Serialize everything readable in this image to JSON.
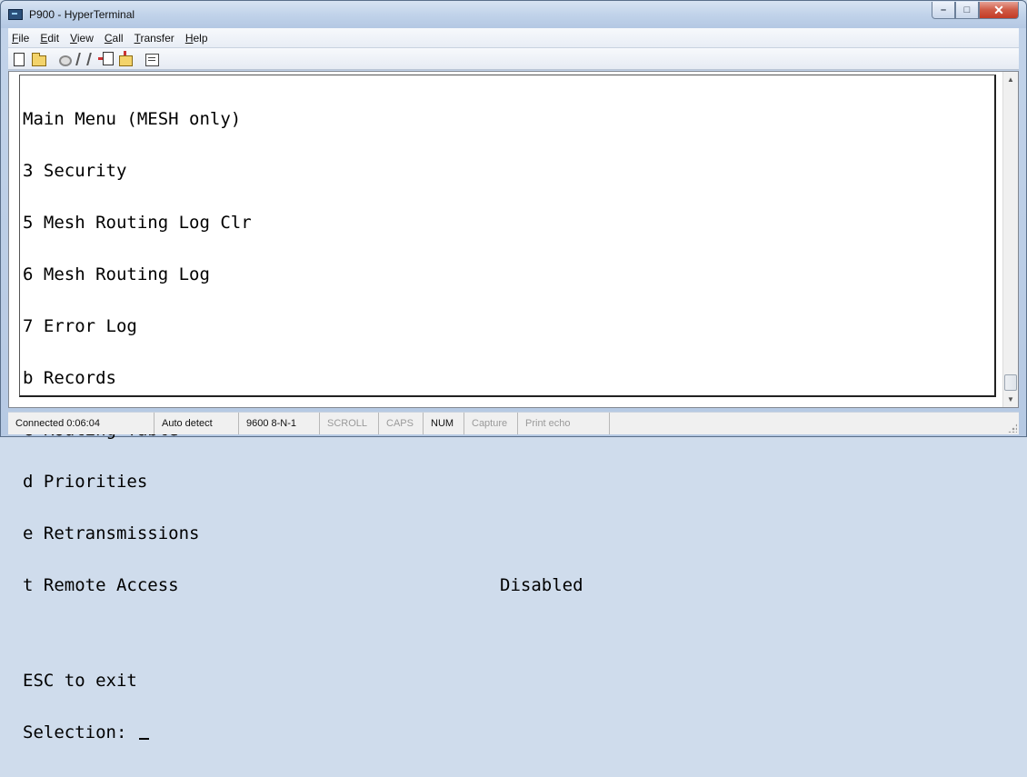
{
  "window": {
    "title": "P900 - HyperTerminal",
    "controls": {
      "minimize": "–",
      "maximize": "□",
      "close": "✕"
    }
  },
  "menubar": [
    {
      "key": "F",
      "rest": "ile"
    },
    {
      "key": "E",
      "rest": "dit",
      "plain": "Edit"
    },
    {
      "key": "V",
      "rest": "iew"
    },
    {
      "key": "C",
      "rest": "all"
    },
    {
      "key": "T",
      "rest": "ransfer"
    },
    {
      "key": "H",
      "rest": "elp"
    }
  ],
  "toolbar": {
    "icons": [
      "new-icon",
      "open-icon",
      "call-icon",
      "disconnect-icon",
      "send-icon",
      "receive-icon",
      "properties-icon"
    ]
  },
  "terminal": {
    "lines": [
      "Main Menu (MESH only)",
      "3 Security",
      "5 Mesh Routing Log Clr",
      "6 Mesh Routing Log",
      "7 Error Log",
      "b Records",
      "c Routing Table",
      "d Priorities",
      "e Retransmissions",
      "t Remote Access"
    ],
    "remote_access_value": "Disabled",
    "exit_hint": "ESC to exit",
    "prompt": "Selection: "
  },
  "statusbar": {
    "connected": "Connected 0:06:04",
    "detect": "Auto detect",
    "settings": "9600 8-N-1",
    "scroll": "SCROLL",
    "caps": "CAPS",
    "num": "NUM",
    "capture": "Capture",
    "print_echo": "Print echo"
  }
}
